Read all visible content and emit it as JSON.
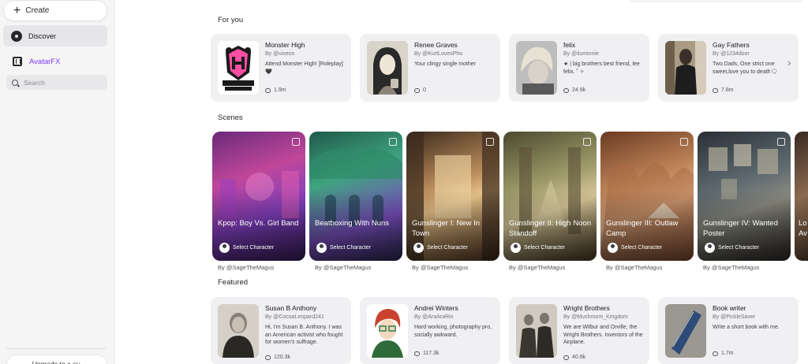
{
  "sidebar": {
    "create_label": "Create",
    "discover_label": "Discover",
    "avatarfx_label": "AvatarFX",
    "search_placeholder": "Search",
    "upgrade_label": "Upgrade to c.ai+"
  },
  "sections": {
    "for_you": "For you",
    "scenes": "Scenes",
    "featured": "Featured"
  },
  "for_you_cards": [
    {
      "name": "Monster High",
      "by": "By @vixeon",
      "desc": "Attend Monster High! [Roleplay] 🖤",
      "chats": "1.9m"
    },
    {
      "name": "Renee Graves",
      "by": "By @KurtLovesPho",
      "desc": "Your clingy single mother",
      "chats": "0"
    },
    {
      "name": "felix",
      "by": "By @iluminnie",
      "desc": "★ | big brothers best friend, lee felix. ˚ ✧",
      "chats": "24.9k"
    },
    {
      "name": "Gay Fathers",
      "by": "By @1234door",
      "desc": "Two Dads, One strict one sweet,love you to death🗨",
      "chats": "7.8m"
    }
  ],
  "scenes": [
    {
      "title": "Kpop: Boy Vs. Girl Band",
      "select": "Select Character",
      "by": "By @SageTheMagus"
    },
    {
      "title": "Beatboxing With Nuns",
      "select": "Select Character",
      "by": "By @SageTheMagus"
    },
    {
      "title": "Gunslinger I: New In Town",
      "select": "Select Character",
      "by": "By @SageTheMagus"
    },
    {
      "title": "Gunslinger II: High Noon Standoff",
      "select": "Select Character",
      "by": "By @SageTheMagus"
    },
    {
      "title": "Gunslinger III: Outlaw Camp",
      "select": "Select Character",
      "by": "By @SageTheMagus"
    },
    {
      "title": "Gunslinger IV: Wanted Poster",
      "select": "Select Character",
      "by": "By @SageTheMagus"
    },
    {
      "title": "Lo Av",
      "select": "",
      "by": ""
    }
  ],
  "featured_cards": [
    {
      "name": "Susan B Anthony",
      "by": "By @CocoaLeopard241",
      "desc": "Hi, I'm Susan B. Anthony. I was an American activist who fought for women's suffrage.",
      "chats": "120.3k"
    },
    {
      "name": "Andrei Winters",
      "by": "By @AraAraRin",
      "desc": "Hard working, photography pro, socially awkward.",
      "chats": "117.3k"
    },
    {
      "name": "Wright Brothers",
      "by": "By @Mushroom_Kingdom",
      "desc": "We are Wilbur and Orville, the Wright Brothers. Inventors of the Airplane.",
      "chats": "40.8k"
    },
    {
      "name": "Book writer",
      "by": "By @PickleSaver",
      "desc": "Write a short book with me.",
      "chats": "1.7m"
    }
  ]
}
